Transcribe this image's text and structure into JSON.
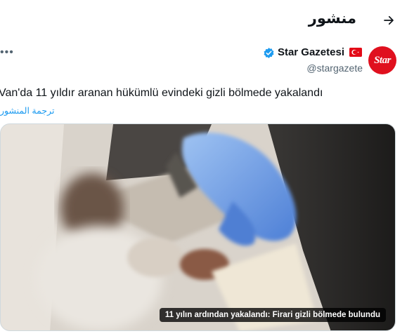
{
  "header": {
    "title": "منشور",
    "back_icon": "arrow-right-icon"
  },
  "author": {
    "name": "Star Gazetesi",
    "handle": "@stargazete",
    "avatar_text": "Star",
    "avatar_color": "#e0101e",
    "flag_icon": "turkey-flag-icon",
    "verified_icon": "verified-badge-icon",
    "verified_color": "#1d9bf0"
  },
  "more_label": "•••",
  "post": {
    "text": "Van'da 11 yıldır aranan hükümlü evindeki gizli bölmede yakalandı",
    "translate_label": "ترجمة المنشور"
  },
  "media": {
    "caption": "11 yılın ardından yakalandı: Firari gizli bölmede bulundu"
  }
}
